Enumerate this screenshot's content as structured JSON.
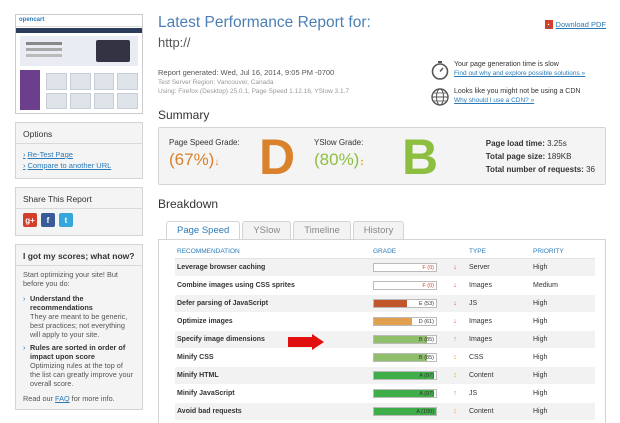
{
  "header": {
    "title": "Latest Performance Report for:",
    "url": "http://",
    "download_pdf": "Download PDF",
    "generated": "Report generated: Wed, Jul 16, 2014, 9:05 PM -0700",
    "server_region": "Test Server Region: Vancouver, Canada",
    "using": "Using: Firefox (Desktop) 25.0.1, Page Speed 1.12.16, YSlow 3.1.7"
  },
  "notes": [
    {
      "text": "Your page generation time is slow",
      "link": "Find out why and explore possible solutions »"
    },
    {
      "text": "Looks like you might not be using a CDN",
      "link": "Why should I use a CDN? »"
    }
  ],
  "thumbnail": {
    "logo": "opencart"
  },
  "options": {
    "title": "Options",
    "links": [
      "Re-Test Page",
      "Compare to another URL"
    ]
  },
  "share": {
    "title": "Share This Report"
  },
  "scores_help": {
    "title": "I got my scores; what now?",
    "intro": "Start optimizing your site! But before you do:",
    "item1_title": "Understand the recommendations",
    "item1_body": "They are meant to be generic, best practices; not everything will apply to your site.",
    "item2_title": "Rules are sorted in order of impact upon score",
    "item2_body": "Optimizing rules at the top of the list can greatly improve your overall score.",
    "footer_pre": "Read our ",
    "footer_link": "FAQ",
    "footer_post": " for more info."
  },
  "summary": {
    "heading": "Summary",
    "pagespeed_label": "Page Speed Grade:",
    "pagespeed_pct": "(67%)",
    "pagespeed_letter": "D",
    "yslow_label": "YSlow Grade:",
    "yslow_pct": "(80%)",
    "yslow_letter": "B",
    "load_time_label": "Page load time:",
    "load_time": "3.25s",
    "size_label": "Total page size:",
    "size": "189KB",
    "requests_label": "Total number of requests:",
    "requests": "36",
    "colors": {
      "pagespeed": "#d9822b",
      "yslow": "#8cbf3f"
    }
  },
  "breakdown": {
    "heading": "Breakdown",
    "tabs": [
      "Page Speed",
      "YSlow",
      "Timeline",
      "History"
    ],
    "columns": [
      "RECOMMENDATION",
      "GRADE",
      "TYPE",
      "PRIORITY"
    ],
    "rows": [
      {
        "rec": "Leverage browser caching",
        "grade": "F (0)",
        "pct": 0,
        "color": "#d23f2b",
        "arrow": "↓",
        "arrow_color": "#d23f2b",
        "type": "Server",
        "priority": "High"
      },
      {
        "rec": "Combine images using CSS sprites",
        "grade": "F (0)",
        "pct": 0,
        "color": "#d23f2b",
        "arrow": "↓",
        "arrow_color": "#d23f2b",
        "type": "Images",
        "priority": "Medium"
      },
      {
        "rec": "Defer parsing of JavaScript",
        "grade": "E (53)",
        "pct": 53,
        "color": "#c0562a",
        "arrow": "↓",
        "arrow_color": "#d23f2b",
        "type": "JS",
        "priority": "High"
      },
      {
        "rec": "Optimize images",
        "grade": "D (61)",
        "pct": 61,
        "color": "#e0a050",
        "arrow": "↓",
        "arrow_color": "#d23f2b",
        "type": "Images",
        "priority": "High"
      },
      {
        "rec": "Specify image dimensions",
        "grade": "B (85)",
        "pct": 85,
        "color": "#8fbf6a",
        "arrow": "↑",
        "arrow_color": "#6aa84f",
        "type": "Images",
        "priority": "High"
      },
      {
        "rec": "Minify CSS",
        "grade": "B (85)",
        "pct": 85,
        "color": "#8fbf6a",
        "arrow": "↕",
        "arrow_color": "#e0a020",
        "type": "CSS",
        "priority": "High"
      },
      {
        "rec": "Minify HTML",
        "grade": "A (97)",
        "pct": 97,
        "color": "#3fae49",
        "arrow": "↕",
        "arrow_color": "#e0a020",
        "type": "Content",
        "priority": "High"
      },
      {
        "rec": "Minify JavaScript",
        "grade": "A (97)",
        "pct": 97,
        "color": "#3fae49",
        "arrow": "↑",
        "arrow_color": "#6aa84f",
        "type": "JS",
        "priority": "High"
      },
      {
        "rec": "Avoid bad requests",
        "grade": "A (100)",
        "pct": 100,
        "color": "#3fae49",
        "arrow": "↕",
        "arrow_color": "#e0a020",
        "type": "Content",
        "priority": "High"
      }
    ]
  }
}
